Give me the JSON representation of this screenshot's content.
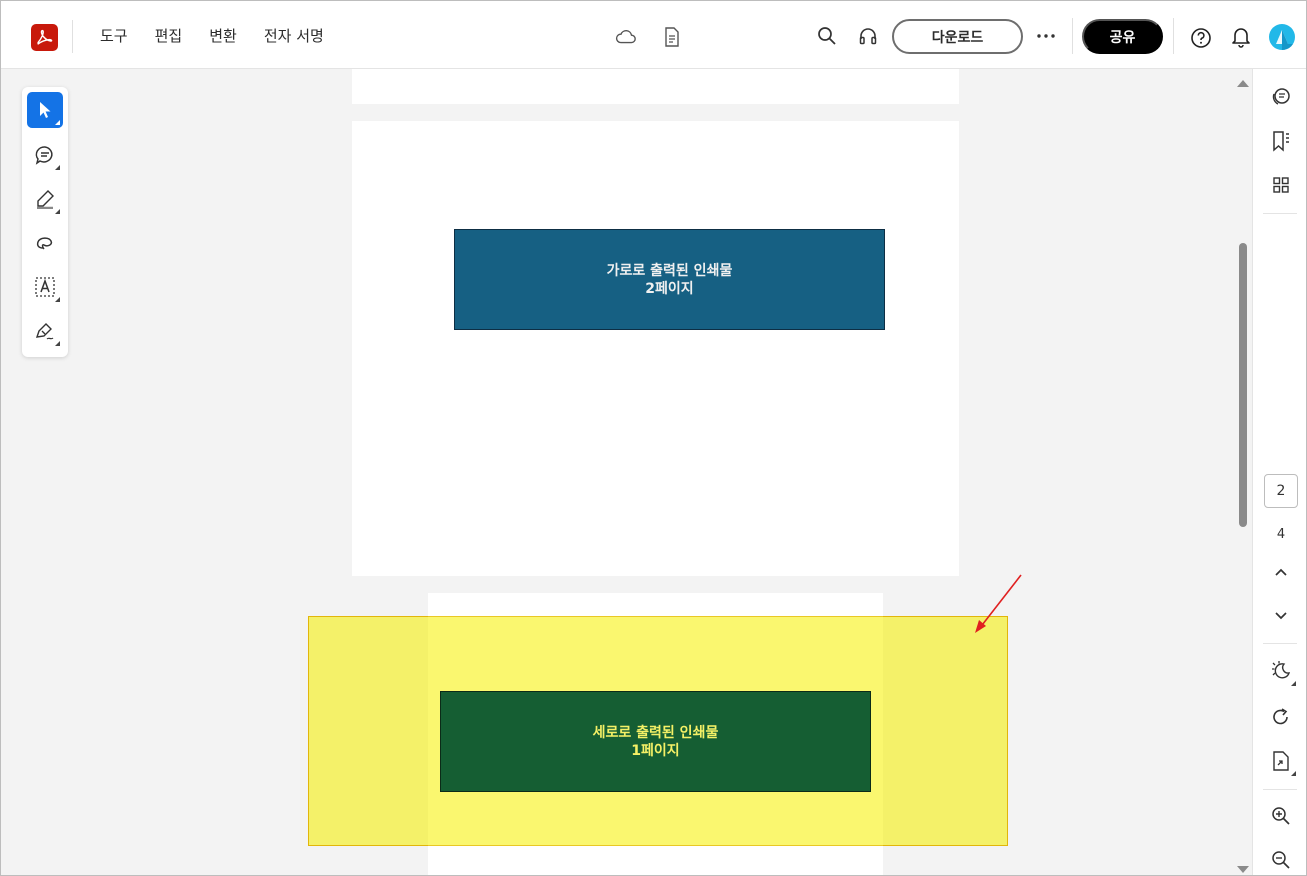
{
  "app": {
    "name": "Adobe Acrobat",
    "accent_color": "#1473e6",
    "logo_color": "#c8190b"
  },
  "topbar": {
    "menu": [
      {
        "label": "도구"
      },
      {
        "label": "편집"
      },
      {
        "label": "변환"
      },
      {
        "label": "전자 서명"
      }
    ],
    "center_icons": [
      "cloud-icon",
      "document-info-icon"
    ],
    "download_label": "다운로드",
    "share_label": "공유",
    "more_icon": "more-icon"
  },
  "left_toolbar": {
    "tools": [
      {
        "name": "select-tool",
        "icon": "cursor-icon",
        "active": true
      },
      {
        "name": "comment-tool",
        "icon": "comment-icon",
        "active": false
      },
      {
        "name": "highlight-tool",
        "icon": "pen-highlight-icon",
        "active": false
      },
      {
        "name": "draw-tool",
        "icon": "lasso-icon",
        "active": false
      },
      {
        "name": "text-tool",
        "icon": "text-box-icon",
        "active": false
      },
      {
        "name": "sign-tool",
        "icon": "signature-pen-icon",
        "active": false
      }
    ]
  },
  "document": {
    "page2": {
      "line1": "가로로 출력된 인쇄물",
      "line2": "2페이지",
      "fill": "#166083"
    },
    "page1": {
      "line1": "세로로 출력된 인쇄물",
      "line2": "1페이지",
      "fill": "#155e33",
      "text_color": "#f4f066"
    },
    "highlight_color": "#f5f028",
    "annotation_arrow_color": "#e02020"
  },
  "right_rail": {
    "top_icons": [
      "comments-panel-icon",
      "bookmark-icon",
      "thumbnails-icon"
    ],
    "current_page": "2",
    "total_pages": "4",
    "bottom_icons": [
      "dark-mode-icon",
      "rotate-icon",
      "extract-page-icon",
      "zoom-in-icon",
      "zoom-out-icon"
    ]
  }
}
